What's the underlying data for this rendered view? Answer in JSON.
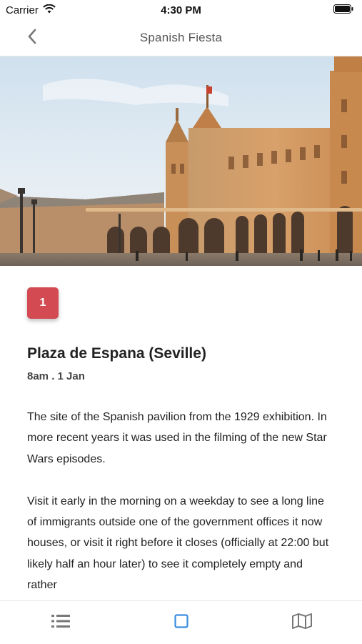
{
  "status_bar": {
    "carrier": "Carrier",
    "time": "4:30 PM"
  },
  "nav": {
    "title": "Spanish Fiesta",
    "back_icon": "chevron-left-icon"
  },
  "hero": {
    "image": "plaza-de-espana-photo"
  },
  "place": {
    "number": "1",
    "title": "Plaza de Espana (Seville)",
    "subtitle": "8am . 1 Jan",
    "paragraph_1": "The site of the Spanish pavilion from the 1929 exhibition. In more recent years it was used in the filming of the new Star Wars episodes.",
    "paragraph_2": "Visit it early in the morning on a weekday to see a long line of immigrants outside one of the government offices it now houses, or visit it right before it closes (officially at 22:00 but likely half an hour later) to see it completely empty and rather"
  },
  "tabs": [
    {
      "icon": "list-icon",
      "active": false
    },
    {
      "icon": "square-icon",
      "active": true
    },
    {
      "icon": "map-icon",
      "active": false
    }
  ],
  "colors": {
    "accent": "#d34a52",
    "tab_active": "#3a8ee0",
    "tab_inactive": "#777777"
  }
}
